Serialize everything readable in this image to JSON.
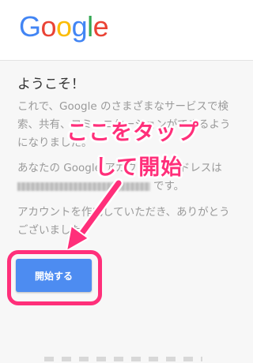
{
  "logo": {
    "letters": [
      "G",
      "o",
      "o",
      "g",
      "l",
      "e"
    ]
  },
  "welcome": "ようこそ！",
  "paragraph1": "これで、Google のさまざまなサービスで検索、共有、コミュニケーションができるようになりました。",
  "paragraph2_prefix": "あなたの Google アカウントのアドレスは",
  "paragraph2_suffix": "です。",
  "paragraph3": "アカウントを作成していただき、ありがとうございました。",
  "overlay": {
    "line1": "ここをタップ",
    "line2": "して開始"
  },
  "start_button": "開始する",
  "colors": {
    "accent_pink": "#ff2f7a",
    "button_blue": "#4d8cf1"
  }
}
